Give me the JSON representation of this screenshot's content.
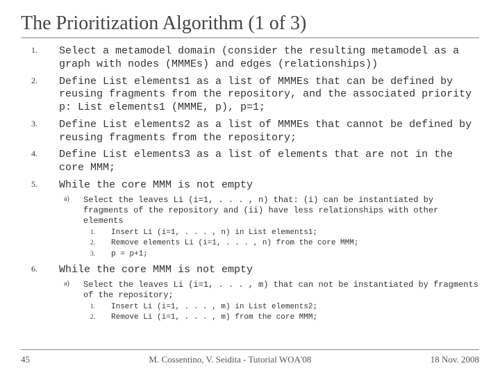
{
  "title": "The Prioritization Algorithm (1 of 3)",
  "steps": {
    "n1": "1.",
    "t1": " Select a metamodel domain (consider the resulting metamodel as a graph with nodes (MMMEs) and edges (relationships))",
    "n2": "2.",
    "t2": "Define List elements1 as a list of MMMEs that can be defined by reusing fragments from the repository, and the associated priority p: List elements1 (MMME, p), p=1;",
    "n3": "3.",
    "t3": "Define List elements2 as a list of MMMEs that cannot be defined by reusing fragments from the repository;",
    "n4": "4.",
    "t4": "Define List elements3 as a list of elements that are not in the core MMM;",
    "n5": "5.",
    "t5": "While the core MMM is not empty",
    "s5a_n": "a)",
    "s5a_t": "Select the leaves Li (i=1, . . . , n) that: (i) can be instantiated by fragments of the repository and (ii) have less relationships with other elements",
    "s5a1_n": "1.",
    "s5a1_t": "Insert Li (i=1, . . . , n) in List elements1;",
    "s5a2_n": "2.",
    "s5a2_t": "Remove elements Li (i=1, . . . , n) from the core MMM;",
    "s5a3_n": "3.",
    "s5a3_t": "p = p+1;",
    "n6": "6.",
    "t6": "While the core MMM is not empty",
    "s6a_n": "a)",
    "s6a_t": "Select the leaves Li (i=1, . . . , m) that can not be instantiated by fragments of the repository;",
    "s6a1_n": "1.",
    "s6a1_t": "Insert Li (i=1, . . . , m) in List elements2;",
    "s6a2_n": "2.",
    "s6a2_t": "Remove Li (i=1, . . . , m) from the core MMM;"
  },
  "footer": {
    "slide": "45",
    "credit": "M. Cossentino, V. Seidita - Tutorial WOA'08",
    "date": "18 Nov. 2008"
  }
}
